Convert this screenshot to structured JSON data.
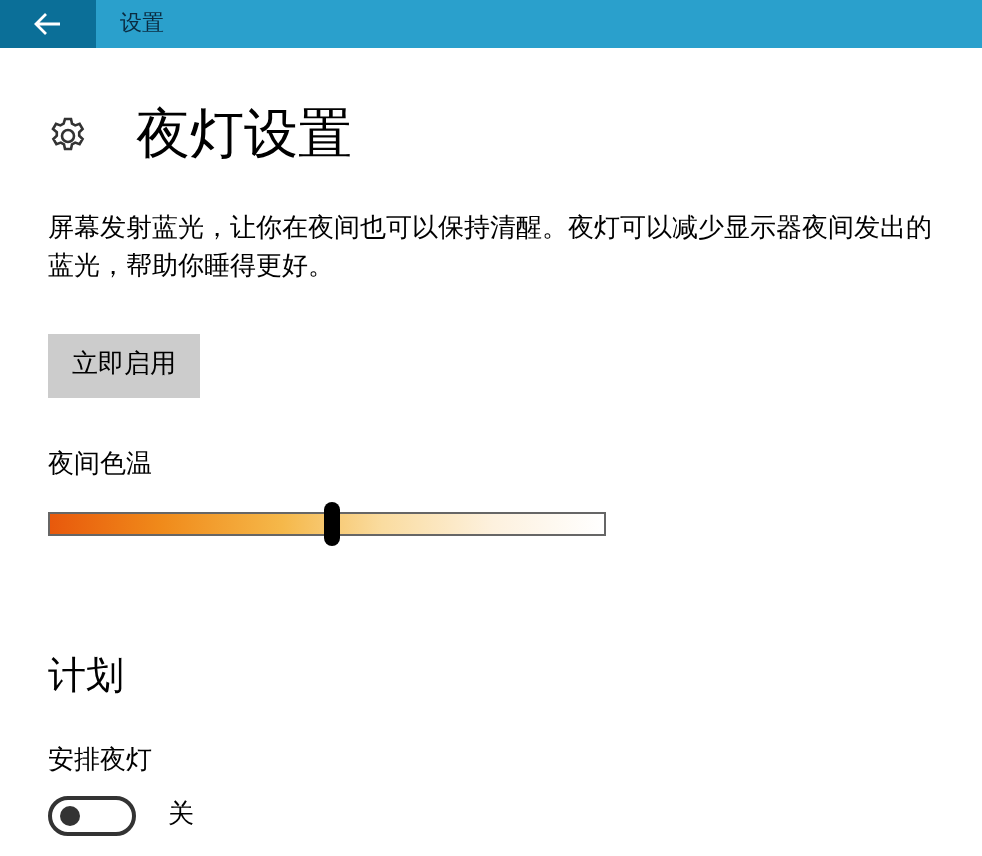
{
  "window": {
    "title": "设置"
  },
  "page": {
    "heading": "夜灯设置",
    "description": "屏幕发射蓝光，让你在夜间也可以保持清醒。夜灯可以减少显示器夜间发出的蓝光，帮助你睡得更好。",
    "button": "立即启用"
  },
  "color_temperature": {
    "label": "夜间色温",
    "level": 0.51
  },
  "schedule": {
    "heading": "计划",
    "label": "安排夜灯",
    "toggle": {
      "on": false,
      "state_text": "关"
    }
  }
}
